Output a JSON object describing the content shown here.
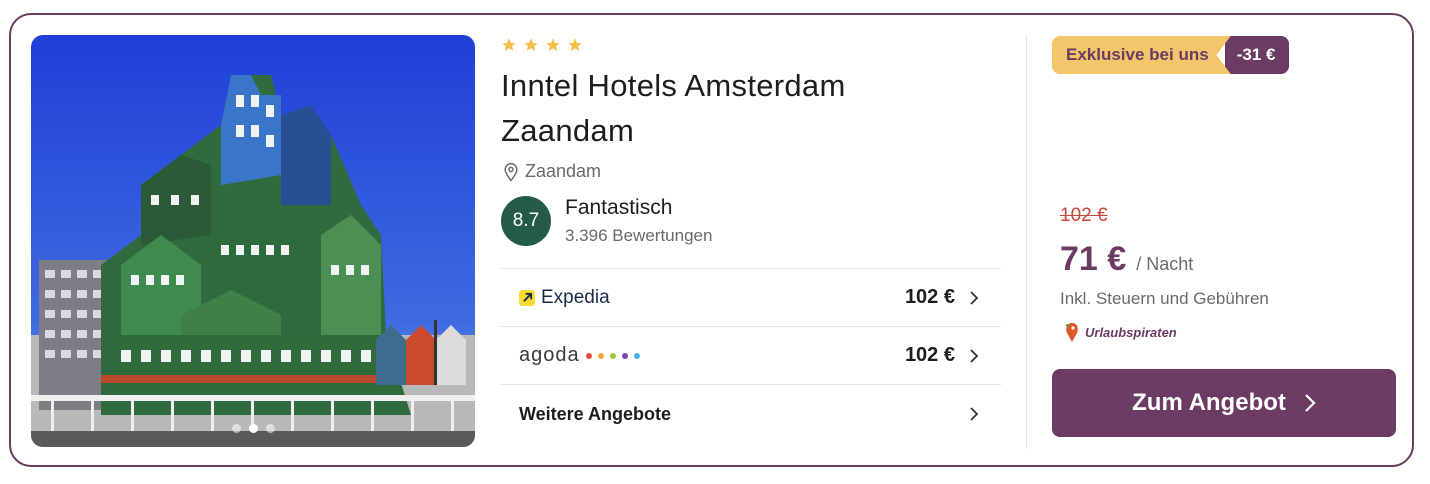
{
  "hotel": {
    "stars": 4,
    "name_line1": "Inntel Hotels Amsterdam",
    "name_line2": "Zaandam",
    "location": "Zaandam",
    "image_alt": "Hotel photo"
  },
  "rating": {
    "score": "8.7",
    "label": "Fantastisch",
    "count": "3.396 Bewertungen"
  },
  "offers": [
    {
      "provider": "Expedia",
      "price": "102 €"
    },
    {
      "provider": "agoda",
      "price": "102 €"
    }
  ],
  "more_offers_label": "Weitere Angebote",
  "deal": {
    "badge_label": "Exklusive bei uns",
    "discount": "-31 €",
    "old_price": "102 €",
    "price": "71 €",
    "per_night": "/ Nacht",
    "taxes_note": "Inkl. Steuern und Gebühren",
    "partner": "Urlaubspiraten",
    "cta_label": "Zum Angebot"
  },
  "colors": {
    "brand": "#6b3b63",
    "badge_yellow": "#f2c76b",
    "rating_green": "#235a49",
    "strike_red": "#c8463a",
    "star": "#f5c04a"
  },
  "carousel": {
    "slides": 3,
    "active": 1
  }
}
